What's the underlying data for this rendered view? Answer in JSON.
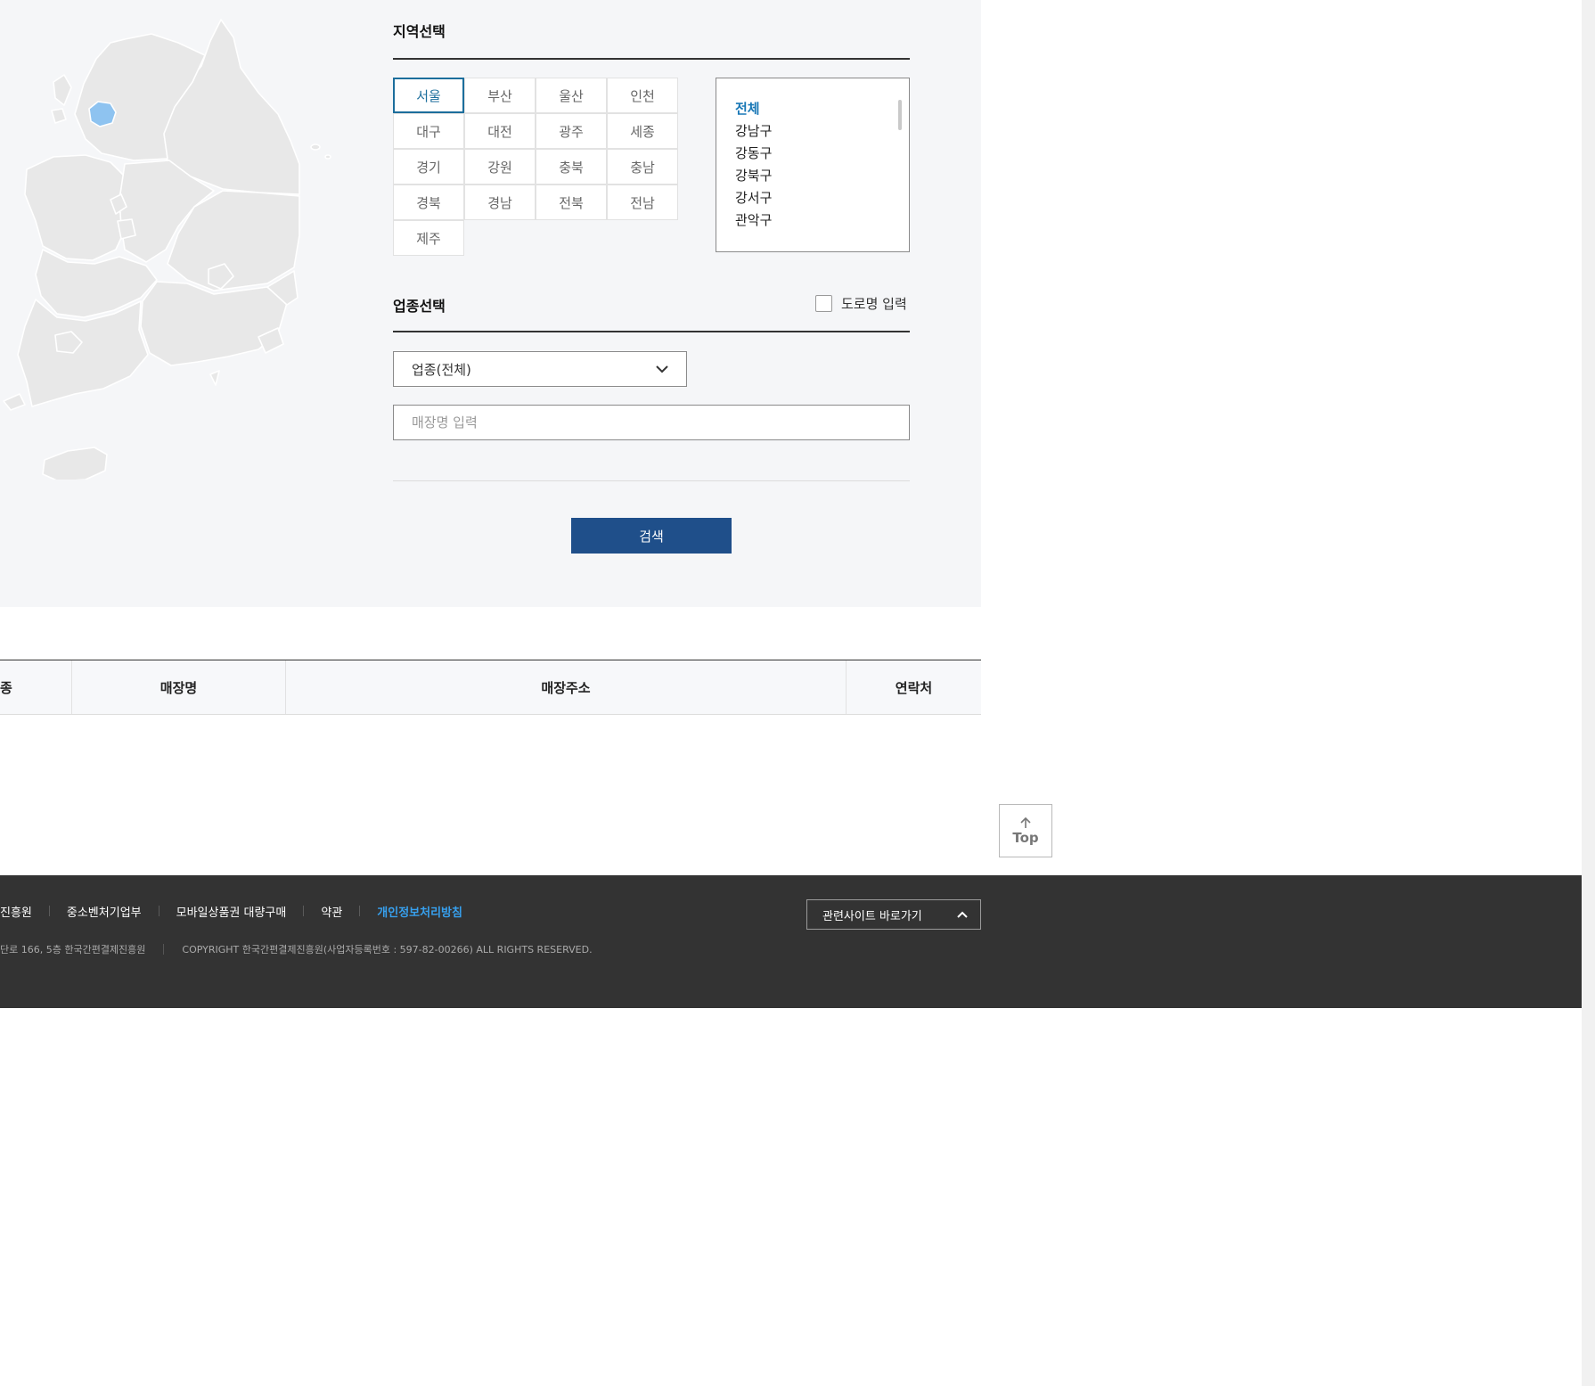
{
  "region_section": {
    "title": "지역선택",
    "regions": [
      "서울",
      "부산",
      "울산",
      "인천",
      "대구",
      "대전",
      "광주",
      "세종",
      "경기",
      "강원",
      "충북",
      "충남",
      "경북",
      "경남",
      "전북",
      "전남",
      "제주"
    ],
    "selected_region": "서울",
    "districts": [
      "전체",
      "강남구",
      "강동구",
      "강북구",
      "강서구",
      "관악구"
    ],
    "selected_district": "전체"
  },
  "category_section": {
    "title": "업종선택",
    "road_name_label": "도로명 입력",
    "road_name_checked": false,
    "category_value": "업종(전체)",
    "store_placeholder": "매장명 입력",
    "search_label": "검색"
  },
  "table": {
    "headers": [
      "종",
      "매장명",
      "매장주소",
      "연락처"
    ]
  },
  "top_button": {
    "label": "Top"
  },
  "footer": {
    "links": [
      "진흥원",
      "중소벤처기업부",
      "모바일상품권 대량구매",
      "약관",
      "개인정보처리방침"
    ],
    "address": "단로 166, 5층 한국간편결제진흥원",
    "copyright": "COPYRIGHT 한국간편결제진흥원(사업자등록번호 : 597-82-00266) ALL RIGHTS RESERVED.",
    "related_sites_label": "관련사이트 바로가기"
  },
  "colors": {
    "panel_bg": "#f5f6f8",
    "accent_selected": "#1c6e9c",
    "district_active": "#1877b6",
    "search_button": "#1f4f8a",
    "footer_bg": "#333333",
    "footer_highlight": "#37a0ee",
    "map_land": "#e8e8e8",
    "map_selected": "#8ec3f0"
  }
}
